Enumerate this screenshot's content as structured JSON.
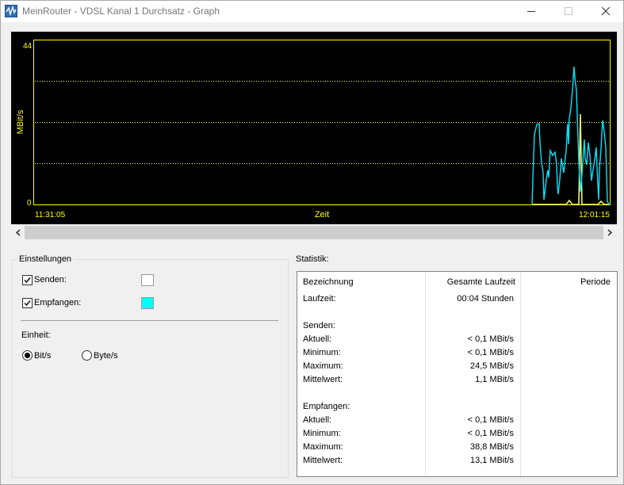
{
  "window": {
    "title": "MeinRouter - VDSL Kanal 1 Durchsatz - Graph"
  },
  "graph": {
    "y_max_label": "44",
    "y_min_label": "0",
    "y_axis_label": "MBit/s",
    "x_start_label": "11:31:05",
    "x_axis_label": "Zeit",
    "x_end_label": "12:01:15",
    "colors": {
      "send": "#ffff80",
      "receive": "#00e5ff",
      "axis": "#ffff00",
      "grid": "#ffff80"
    }
  },
  "settings": {
    "title": "Einstellungen",
    "send": {
      "label": "Senden:",
      "checked": true,
      "color": "#ffffff"
    },
    "receive": {
      "label": "Empfangen:",
      "checked": true,
      "color": "#00ffff"
    },
    "unit_label": "Einheit:",
    "unit_options": [
      "Bit/s",
      "Byte/s"
    ],
    "unit_selected": "Bit/s"
  },
  "statistics": {
    "title": "Statistik:",
    "headers": [
      "Bezeichnung",
      "Gesamte Laufzeit",
      "Periode"
    ],
    "rows": [
      {
        "label": "Laufzeit:",
        "total": "00:04 Stunden",
        "period": ""
      },
      {
        "label": "",
        "total": "",
        "period": ""
      },
      {
        "label": "Senden:",
        "total": "",
        "period": ""
      },
      {
        "label": "Aktuell:",
        "total": "< 0,1 MBit/s",
        "period": ""
      },
      {
        "label": "Minimum:",
        "total": "< 0,1 MBit/s",
        "period": ""
      },
      {
        "label": "Maximum:",
        "total": "24,5 MBit/s",
        "period": ""
      },
      {
        "label": "Mittelwert:",
        "total": "1,1 MBit/s",
        "period": ""
      },
      {
        "label": "",
        "total": "",
        "period": ""
      },
      {
        "label": "Empfangen:",
        "total": "",
        "period": ""
      },
      {
        "label": "Aktuell:",
        "total": "< 0,1 MBit/s",
        "period": ""
      },
      {
        "label": "Minimum:",
        "total": "< 0,1 MBit/s",
        "period": ""
      },
      {
        "label": "Maximum:",
        "total": "38,8 MBit/s",
        "period": ""
      },
      {
        "label": "Mittelwert:",
        "total": "13,1 MBit/s",
        "period": ""
      }
    ]
  }
}
